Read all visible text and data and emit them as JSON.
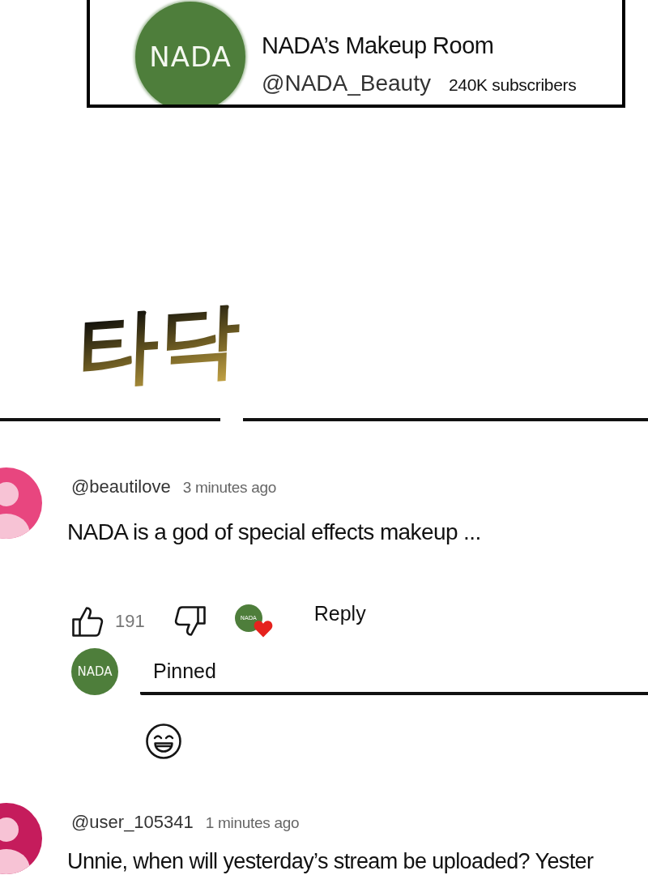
{
  "channel_card": {
    "avatar_text": "NADA",
    "name": "NADA’s Makeup Room",
    "handle": "@NADA_Beauty",
    "subscribers": "240K subscribers"
  },
  "sound_effect": "타닥",
  "comments": [
    {
      "author": "@beautilove",
      "time": "3 minutes ago",
      "text": "NADA is a god of special effects makeup ...",
      "color": "#e8467f",
      "likes": "191",
      "hearted": true,
      "heart_avatar_text": "NADA",
      "reply_label": "Reply",
      "reply_box": {
        "avatar_text": "NADA",
        "value": "Pinned"
      }
    },
    {
      "author": "@user_105341",
      "time": "1 minutes ago",
      "text": "Unnie, when will yesterday’s stream be uploaded? Yester",
      "color": "#c51c5c"
    }
  ]
}
